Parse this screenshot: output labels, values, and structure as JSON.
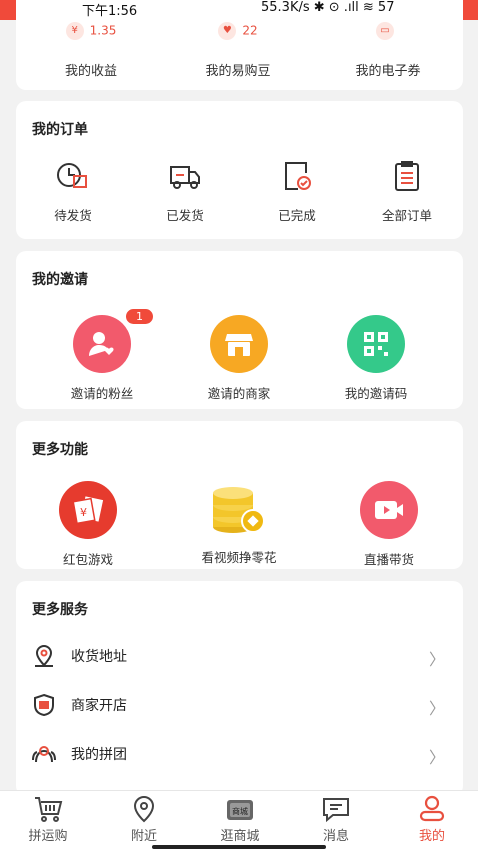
{
  "status_bar": {
    "time": "下午1:56",
    "right": "55.3K/s ✱ ⊙ .ıll ≋ 57"
  },
  "stats": [
    {
      "value": "1.35",
      "label": "我的收益",
      "icon": "money-bag-icon"
    },
    {
      "value": "22",
      "label": "我的易购豆",
      "icon": "heart-coin-icon"
    },
    {
      "value": "",
      "label": "我的电子券",
      "icon": "ticket-icon"
    }
  ],
  "orders": {
    "title": "我的订单",
    "items": [
      {
        "label": "待发货",
        "icon": "clock-box-icon"
      },
      {
        "label": "已发货",
        "icon": "truck-icon"
      },
      {
        "label": "已完成",
        "icon": "check-doc-icon"
      },
      {
        "label": "全部订单",
        "icon": "clipboard-icon"
      }
    ]
  },
  "invites": {
    "title": "我的邀请",
    "items": [
      {
        "label": "邀请的粉丝",
        "badge": "1",
        "icon": "fans-icon",
        "color": "#f25a6c"
      },
      {
        "label": "邀请的商家",
        "icon": "shop-icon",
        "color": "#f7a823"
      },
      {
        "label": "我的邀请码",
        "icon": "qrcode-icon",
        "color": "#34c98a"
      }
    ]
  },
  "more_features": {
    "title": "更多功能",
    "items": [
      {
        "label": "红包游戏",
        "icon": "red-envelope-icon"
      },
      {
        "label": "看视频挣零花",
        "icon": "coins-icon"
      },
      {
        "label": "直播带货",
        "icon": "live-video-icon"
      }
    ]
  },
  "more_services": {
    "title": "更多服务",
    "items": [
      {
        "label": "收货地址",
        "icon": "location-icon"
      },
      {
        "label": "商家开店",
        "icon": "shop-shield-icon"
      },
      {
        "label": "我的拼团",
        "icon": "group-icon"
      }
    ]
  },
  "tabbar": [
    {
      "label": "拼运购",
      "icon": "cart-icon"
    },
    {
      "label": "附近",
      "icon": "pin-icon"
    },
    {
      "label": "逛商城",
      "icon": "mall-icon",
      "icon_text": "商城"
    },
    {
      "label": "消息",
      "icon": "message-icon"
    },
    {
      "label": "我的",
      "icon": "person-icon",
      "active": true
    }
  ],
  "colors": {
    "accent": "#e8503f",
    "background": "#f2f2f2"
  }
}
